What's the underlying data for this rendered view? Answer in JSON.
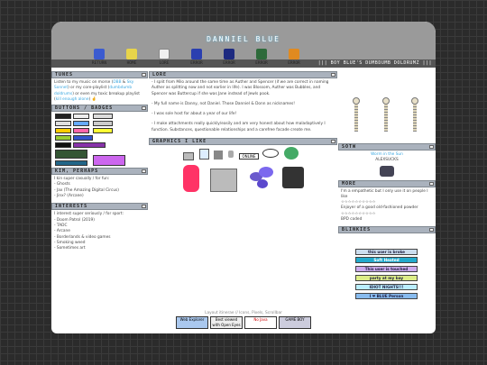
{
  "header": {
    "title": "DANNIEL BLUE",
    "tagline": "||| BOY BLUE'S DUMBDUMB DOLDRUMZ |||"
  },
  "nav": [
    {
      "label": "RETURN",
      "icon": "return-icon",
      "color": "#3b5bd0"
    },
    {
      "label": "HOME",
      "icon": "home-icon",
      "color": "#e8d44a"
    },
    {
      "label": "LORE",
      "icon": "lore-icon",
      "color": "#f0f0f0"
    },
    {
      "label": "ERROR",
      "icon": "error-icon",
      "color": "#2a3fb0"
    },
    {
      "label": "ERROR",
      "icon": "error-icon",
      "color": "#1d2a80"
    },
    {
      "label": "ERROR",
      "icon": "error-icon",
      "color": "#2d6a3a"
    },
    {
      "label": "ERROR",
      "icon": "error-icon",
      "color": "#e08a20"
    }
  ],
  "tunes": {
    "heading": "TUNES",
    "text_a": "Listen to my music on morse (",
    "link_a": "DBB",
    "text_b": " & ",
    "link_b": "Sky Sonnet",
    "text_c": ") or my core-playlist (",
    "link_c": "dumbdumb doldrums",
    "text_d": ") or even my toxic breakup playlist (",
    "link_d": "kill enough alone",
    "text_e": ") 🤞"
  },
  "buttons_badges": {
    "heading": "BUTTONS / BADGES"
  },
  "kim_perhaps": {
    "heading": "KIM, PERHAPS",
    "intro": "I kin super casually / for fun:",
    "items": [
      "Ghosts",
      "Jax (The Amazing Digital Circus)",
      "Jinx? (Arcane)"
    ]
  },
  "interests": {
    "heading": "INTERESTS",
    "intro": "I interest super seriously / for sport:",
    "items": [
      "Doom Patrol (2019)",
      "TADC",
      "Arcane",
      "Borderlands & video games",
      "Smoking weed",
      "Sometimes art"
    ]
  },
  "lore": {
    "heading": "LORE",
    "para1": "- I split from Milo around the same time as Auther and Spencer (if we are correct in naming Auther as splitting now and not earlier in life). I was Blossom, Auther was Bubbles, and Spencer was Buttercup if she was Jane instead of Jewls pook.",
    "para2": "- My full name is Danny, not Daniel. Those Danniel & Donn as nicknames!",
    "para3": "- I was sole host for about a year of our life!",
    "para4": "- I make attachments really quickly/easily and am very honest about how maladaptively I function. Substances, questionable relationships and a carefree facade create me."
  },
  "graphics": {
    "heading": "GRAPHICS I LIKE",
    "online_label": "ONLINE"
  },
  "sotw": {
    "heading": "SOTW",
    "song": "Worm in the Sun",
    "artist": "ALEXSUCKS"
  },
  "more": {
    "heading": "MORE",
    "line1": "I'm a empathetic but I only use it on people I like",
    "stars1": "☆☆☆☆☆☆☆☆☆☆",
    "line2": "Enjoyer of a good old-fashioned powder",
    "stars2": "☆☆☆☆☆☆☆☆☆☆",
    "line3": "BPD coded"
  },
  "blinkies": {
    "heading": "BLINKIES",
    "items": [
      "this user is broke",
      "Soft Heated",
      "This user is touched",
      "party at my bay",
      "IDIOT NIGHTS!!!",
      "I ❤ BLUE Person"
    ]
  },
  "footer": {
    "text": "Layout itinerae // Icons, Pixels, Scrollbar",
    "buttons": [
      "Web Explorer",
      "Best viewed with Open Eyes",
      "No Java",
      "GAME BOY"
    ]
  }
}
